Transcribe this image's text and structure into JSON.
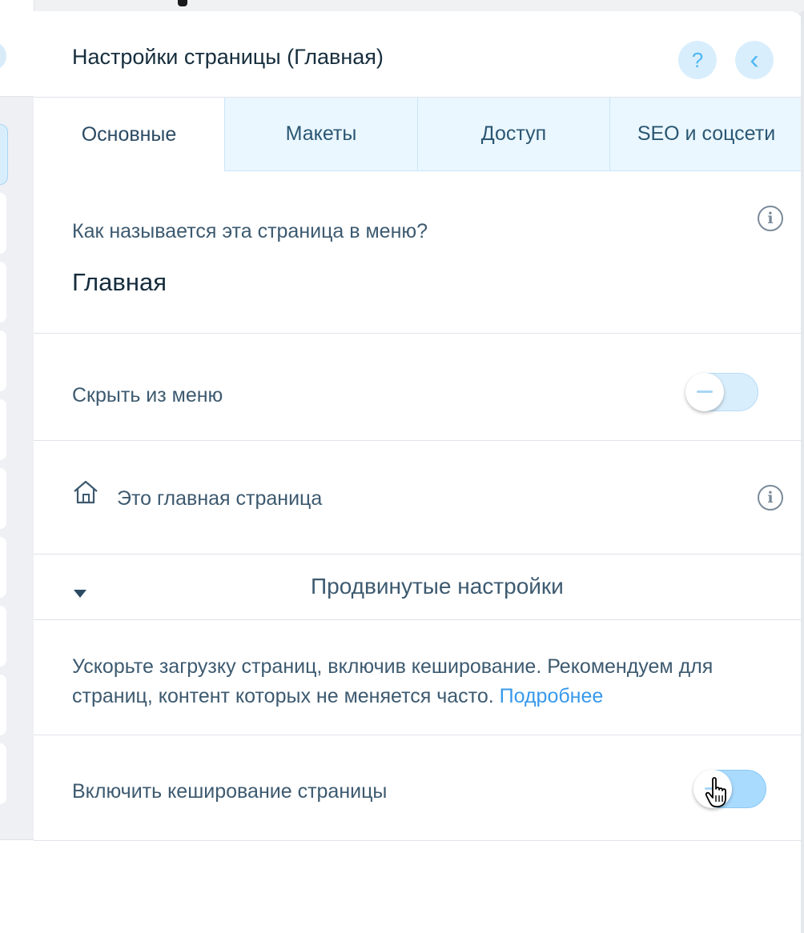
{
  "panel": {
    "title": "Настройки страницы (Главная)",
    "help_icon_glyph": "?",
    "back_icon_glyph": "‹"
  },
  "tabs": [
    {
      "label": "Основные",
      "active": true
    },
    {
      "label": "Макеты",
      "active": false
    },
    {
      "label": "Доступ",
      "active": false
    },
    {
      "label": "SEO и соцсети",
      "active": false
    }
  ],
  "menu_name": {
    "question": "Как называется эта страница в меню?",
    "value": "Главная",
    "info_icon": "info-icon"
  },
  "hide_from_menu": {
    "label": "Скрыть из меню",
    "toggle_on": false
  },
  "home_page": {
    "label": "Это главная страница",
    "icon": "home-icon",
    "info_icon": "info-icon"
  },
  "advanced": {
    "label": "Продвинутые настройки",
    "expanded": true
  },
  "caching": {
    "description": "Ускорьте загрузку страниц, включив кеширование. Рекомендуем для страниц, контент которых не меняется часто.",
    "link": "Подробнее",
    "toggle_label": "Включить кеширование страницы",
    "toggle_on": false
  },
  "colors": {
    "accent": "#3899ec",
    "toggle_bg": "#d9eefc",
    "tab_inactive_bg": "#eaf7ff",
    "text_dark": "#162d3d"
  }
}
